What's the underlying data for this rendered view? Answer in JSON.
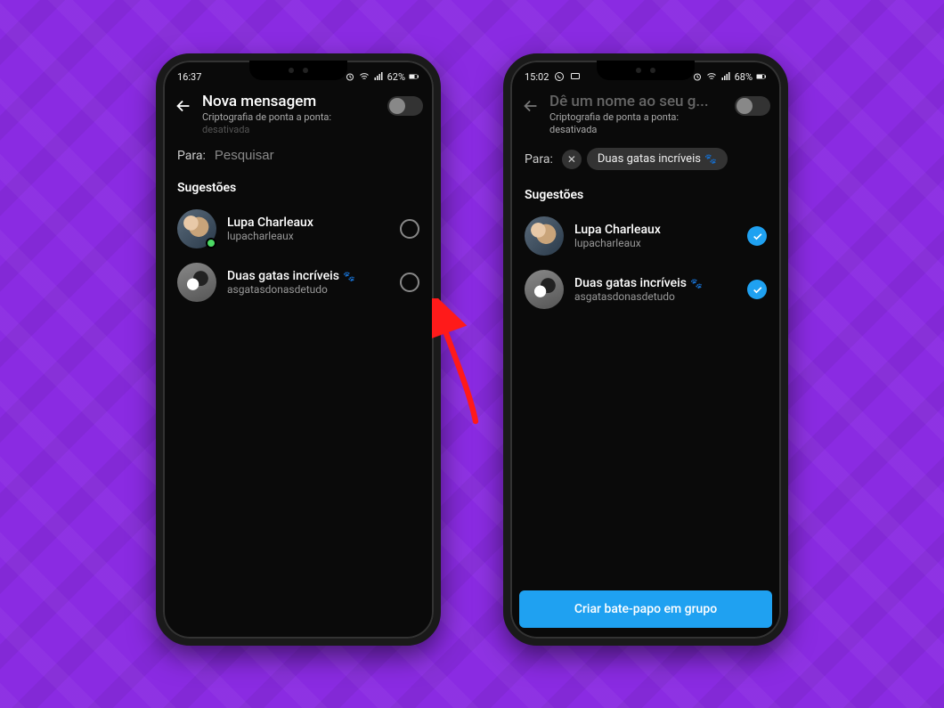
{
  "phone_left": {
    "status": {
      "time": "16:37",
      "battery": "62%"
    },
    "header": {
      "title": "Nova mensagem",
      "subtitle_line1": "Criptografia de ponta a ponta:",
      "subtitle_line2": "desativada"
    },
    "para_label": "Para:",
    "search_placeholder": "Pesquisar",
    "section_title": "Sugestões",
    "contacts": [
      {
        "name": "Lupa Charleaux",
        "username": "lupacharleaux",
        "online": true,
        "paw": false
      },
      {
        "name": "Duas gatas incríveis",
        "username": "asgatasdonasdetudo",
        "online": false,
        "paw": true
      }
    ]
  },
  "phone_right": {
    "status": {
      "time": "15:02",
      "battery": "68%"
    },
    "header": {
      "title": "Dê um nome ao seu g...",
      "subtitle_line1": "Criptografia de ponta a ponta:",
      "subtitle_line2": "desativada"
    },
    "para_label": "Para:",
    "chip_label": "Duas gatas incríveis",
    "section_title": "Sugestões",
    "contacts": [
      {
        "name": "Lupa Charleaux",
        "username": "lupacharleaux",
        "online": false,
        "paw": false
      },
      {
        "name": "Duas gatas incríveis",
        "username": "asgatasdonasdetudo",
        "online": false,
        "paw": true
      }
    ],
    "create_button": "Criar bate-papo em grupo"
  },
  "icons": {
    "paws": "🐾"
  }
}
